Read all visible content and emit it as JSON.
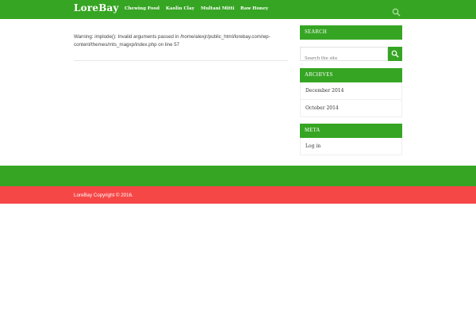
{
  "header": {
    "logo": "LoreBay",
    "nav": [
      "Chewing Food",
      "Kaolin Clay",
      "Multani Mitti",
      "Raw Honey"
    ]
  },
  "main": {
    "warning": "Warning: implode(): Invalid arguments passed in /home/alexjr/public_html/lorebay.com/wp-content/themes/mts_magxp/index.php on line 57"
  },
  "sidebar": {
    "search": {
      "title": "SEARCH",
      "placeholder": "Search the site"
    },
    "archives": {
      "title": "ARCHIVES",
      "items": [
        "December 2014",
        "October 2014"
      ]
    },
    "meta": {
      "title": "META",
      "items": [
        "Log in"
      ]
    }
  },
  "footer": {
    "copyright": "LoreBay Copyright © 2016."
  },
  "colors": {
    "brand_green": "#36a523",
    "footer_red": "#f64747"
  }
}
